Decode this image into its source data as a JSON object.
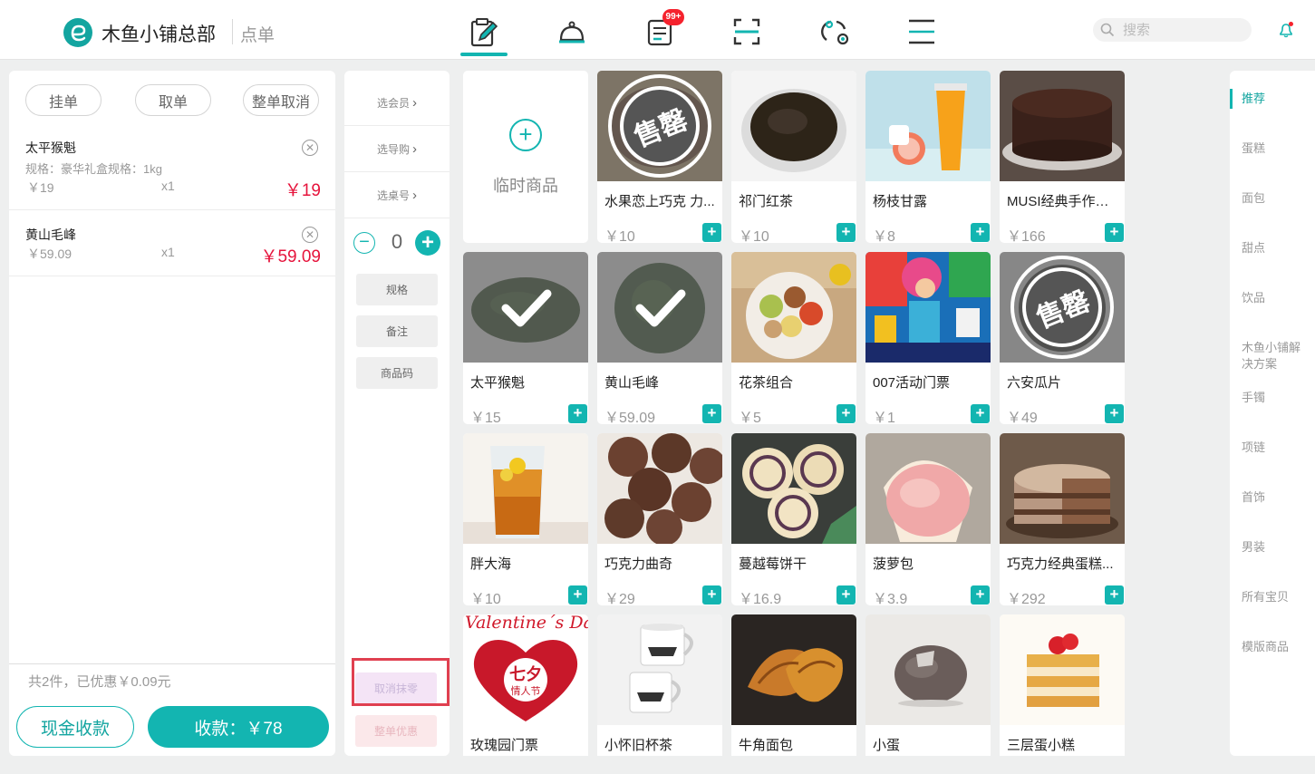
{
  "header": {
    "brand": "木鱼小铺总部",
    "page": "点单",
    "badge": "99+",
    "search_placeholder": "搜索",
    "nav_icons": [
      "order-edit-icon",
      "service-bell-icon",
      "bill-list-icon",
      "scan-icon",
      "exchange-icon",
      "menu-icon"
    ]
  },
  "order": {
    "actions": [
      "挂单",
      "取单",
      "整单取消"
    ],
    "items": [
      {
        "name": "太平猴魁",
        "spec": "规格：豪华礼盒规格：1kg",
        "price": "￥19",
        "qty": "x1",
        "total": "￥19"
      },
      {
        "name": "黄山毛峰",
        "spec": "",
        "price": "￥59.09",
        "qty": "x1",
        "total": "￥59.09"
      }
    ],
    "summary": "共2件，已优惠￥0.09元",
    "cash_label": "现金收款",
    "pay_label": "收款：￥78"
  },
  "actions": {
    "select_member": "选会员",
    "select_guide": "选导购",
    "select_table": "选桌号",
    "quantity": "0",
    "spec": "规格",
    "note": "备注",
    "product_code": "商品码",
    "cancel_rounding": "取消抹零",
    "order_discount": "整单优惠"
  },
  "temp_product": "临时商品",
  "products": [
    {
      "name": "水果恋上巧克 力...",
      "price": "￥10",
      "status": "sold-out"
    },
    {
      "name": "祁门红茶",
      "price": "￥10",
      "status": ""
    },
    {
      "name": "杨枝甘露",
      "price": "￥8",
      "status": ""
    },
    {
      "name": "MUSI经典手作蛋糕",
      "price": "￥166",
      "status": ""
    },
    {
      "name": "太平猴魁",
      "price": "￥15",
      "status": "selected"
    },
    {
      "name": "黄山毛峰",
      "price": "￥59.09",
      "status": "selected"
    },
    {
      "name": "花茶组合",
      "price": "￥5",
      "status": ""
    },
    {
      "name": "007活动门票",
      "price": "￥1",
      "status": ""
    },
    {
      "name": "六安瓜片",
      "price": "￥49",
      "status": "sold-out"
    },
    {
      "name": "胖大海",
      "price": "￥10",
      "status": ""
    },
    {
      "name": "巧克力曲奇",
      "price": "￥29",
      "status": ""
    },
    {
      "name": "蔓越莓饼干",
      "price": "￥16.9",
      "status": ""
    },
    {
      "name": "菠萝包",
      "price": "￥3.9",
      "status": ""
    },
    {
      "name": "巧克力经典蛋糕...",
      "price": "￥292",
      "status": ""
    },
    {
      "name": "玫瑰园门票",
      "price": "",
      "status": ""
    },
    {
      "name": "小怀旧杯茶",
      "price": "",
      "status": ""
    },
    {
      "name": "牛角面包",
      "price": "",
      "status": ""
    },
    {
      "name": "小蛋",
      "price": "",
      "status": ""
    },
    {
      "name": "三层蛋小糕",
      "price": "",
      "status": ""
    }
  ],
  "sold_out_label": "售罄",
  "image_texts": {
    "valentine": "Valentine´s Day",
    "qixi": "七夕",
    "qixi_sub": "情人节"
  },
  "categories": [
    "推荐",
    "蛋糕",
    "面包",
    "甜点",
    "饮品",
    "木鱼小铺解决方案",
    "手镯",
    "项链",
    "首饰",
    "男装",
    "所有宝贝",
    "模版商品"
  ],
  "colors": {
    "accent": "#13b5b1",
    "price_red": "#e6143c",
    "badge_red": "#f5222d"
  }
}
